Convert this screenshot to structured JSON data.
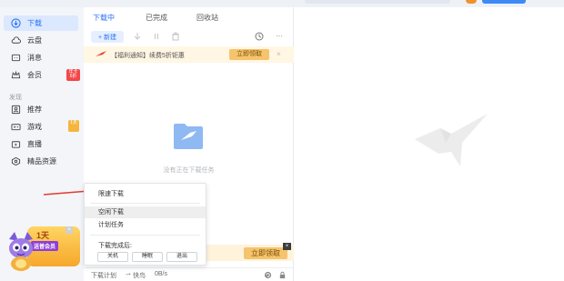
{
  "sidebar": {
    "items": [
      {
        "label": "下载",
        "icon": "download-icon",
        "active": true
      },
      {
        "label": "云盘",
        "icon": "cloud-icon"
      },
      {
        "label": "消息",
        "icon": "message-icon"
      },
      {
        "label": "会员",
        "icon": "crown-icon",
        "badge": "年卡5折"
      },
      {
        "label": "推荐",
        "icon": "recommend-icon"
      },
      {
        "label": "游戏",
        "icon": "gamepad-icon",
        "badge": "1天"
      },
      {
        "label": "直播",
        "icon": "live-icon"
      },
      {
        "label": "精品资源",
        "icon": "gem-icon"
      }
    ],
    "section_label": "发现",
    "promo": {
      "days": "1天",
      "caption": "送普会员"
    }
  },
  "tabs": [
    "下载中",
    "已完成",
    "回收站"
  ],
  "toolbar": {
    "new_label": "+ 新建"
  },
  "notice": {
    "text": "【福利通知】续费5折钜惠",
    "button": "立即领取"
  },
  "empty_text": "没有正在下载任务",
  "bottom_promo": {
    "button": "立即领取"
  },
  "status": {
    "plan": "下载计划",
    "speed_label": "快鸟",
    "speed": "0B/s"
  },
  "menu": {
    "items": [
      "限速下载",
      "空闲下载",
      "计划任务"
    ],
    "after_label": "下载完成后:",
    "buttons": [
      "关机",
      "睡眠",
      "退出"
    ]
  },
  "colors": {
    "accent": "#2a72f5",
    "promo": "#f5c46c",
    "sidebar_bg": "#f3f5f9"
  }
}
